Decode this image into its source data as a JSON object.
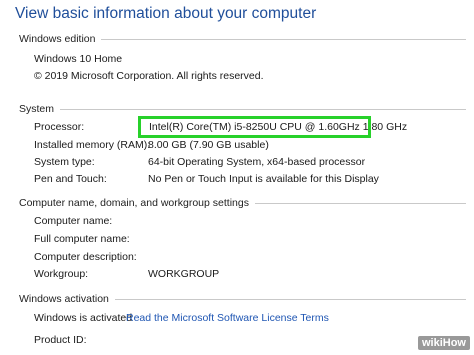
{
  "heading": "View basic information about your computer",
  "windows_edition": {
    "section_title": "Windows edition",
    "edition": "Windows 10 Home",
    "copyright": "© 2019 Microsoft Corporation. All rights reserved."
  },
  "system": {
    "section_title": "System",
    "rows": [
      {
        "label": "Processor:",
        "value": "Intel(R) Core(TM) i5-8250U CPU @ 1.60GHz   1.80 GHz"
      },
      {
        "label": "Installed memory (RAM):",
        "value": "8.00 GB (7.90 GB usable)"
      },
      {
        "label": "System type:",
        "value": "64-bit Operating System, x64-based processor"
      },
      {
        "label": "Pen and Touch:",
        "value": "No Pen or Touch Input is available for this Display"
      }
    ],
    "highlight_color": "#27d12a"
  },
  "computer_name": {
    "section_title": "Computer name, domain, and workgroup settings",
    "rows": [
      {
        "label": "Computer name:",
        "value": ""
      },
      {
        "label": "Full computer name:",
        "value": ""
      },
      {
        "label": "Computer description:",
        "value": ""
      },
      {
        "label": "Workgroup:",
        "value": "WORKGROUP"
      }
    ]
  },
  "activation": {
    "section_title": "Windows activation",
    "status": "Windows is activated",
    "license_link": "Read the Microsoft Software License Terms",
    "product_id_label": "Product ID:"
  },
  "watermark": {
    "wiki": "wiki",
    "how": "How"
  },
  "colors": {
    "heading": "#1f4e9a",
    "link": "#1f56b3"
  }
}
